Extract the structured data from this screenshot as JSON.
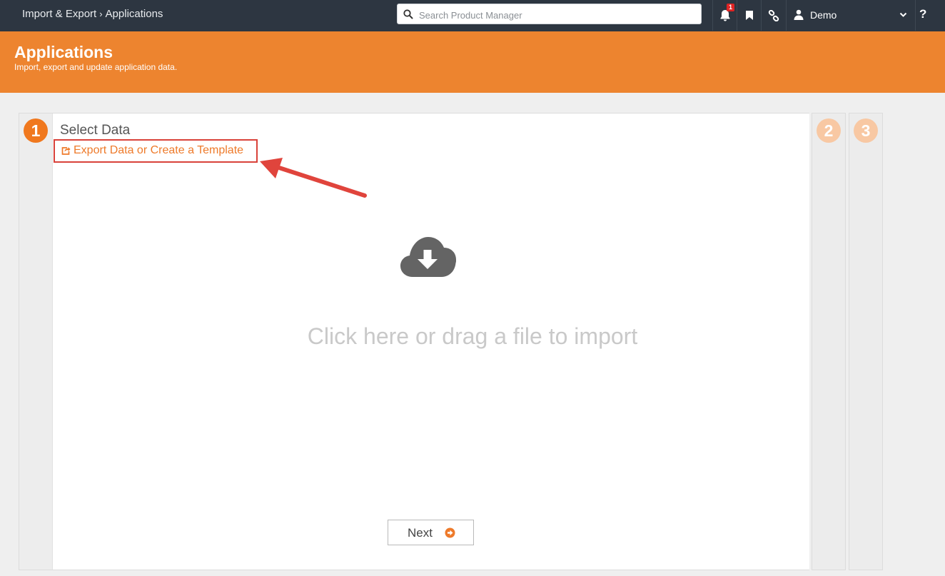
{
  "topbar": {
    "breadcrumb": [
      "Import & Export",
      "Applications"
    ],
    "breadcrumb_separator": "›",
    "search_placeholder": "Search Product Manager",
    "notification_count": "1",
    "user_name": "Demo",
    "help_label": "?"
  },
  "header": {
    "title": "Applications",
    "subtitle": "Import, export and update application data."
  },
  "steps": [
    {
      "number": "1",
      "state": "active"
    },
    {
      "number": "2",
      "state": "inactive"
    },
    {
      "number": "3",
      "state": "inactive"
    }
  ],
  "step1": {
    "title": "Select Data",
    "export_link": "Export Data or Create a Template",
    "drop_text": "Click here or drag a file to import",
    "next_label": "Next"
  },
  "icons": {
    "search": "search-icon",
    "bell": "bell-icon",
    "bookmark": "bookmark-icon",
    "link": "link-icon",
    "user": "user-icon",
    "chevron": "chevron-down-icon",
    "export": "share-square-icon",
    "cloud": "cloud-download-icon",
    "next": "arrow-circle-right-icon"
  },
  "colors": {
    "topbar": "#2d3641",
    "accent": "#ed842f",
    "highlight_box": "#d9423a",
    "badge": "#e02424"
  }
}
